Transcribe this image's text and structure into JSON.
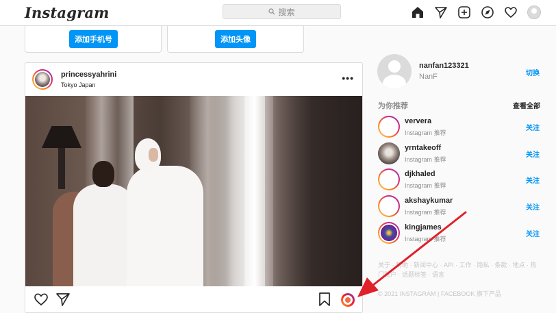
{
  "nav": {
    "logo": "Instagram",
    "search_placeholder": "搜索",
    "icons": [
      "home-icon",
      "direct-icon",
      "new-post-icon",
      "explore-icon",
      "activity-icon",
      "profile-avatar"
    ]
  },
  "cards": [
    {
      "button": "添加手机号"
    },
    {
      "button": "添加头像"
    }
  ],
  "post": {
    "username": "princessyahrini",
    "location": "Tokyo Japan",
    "more": "•••"
  },
  "me": {
    "username": "nanfan123321",
    "fullname": "NanF",
    "switch": "切换"
  },
  "suggestions": {
    "title": "为你推荐",
    "see_all": "查看全部",
    "items": [
      {
        "name": "ververa",
        "sub": "Instagram 推荐",
        "action": "关注"
      },
      {
        "name": "yrntakeoff",
        "sub": "Instagram 推荐",
        "action": "关注"
      },
      {
        "name": "djkhaled",
        "sub": "Instagram 推荐",
        "action": "关注"
      },
      {
        "name": "akshaykumar",
        "sub": "Instagram 推荐",
        "action": "关注"
      },
      {
        "name": "kingjames",
        "sub": "Instagram 推荐",
        "action": "关注"
      }
    ]
  },
  "footer": {
    "links": "关于 · 帮助 · 新闻中心 · API · 工作 · 隐私 · 条款 · 地点 · 热门账户 · 话题标签 · 语言",
    "copyright": "© 2021 INSTAGRAM | FACEBOOK 旗下产品"
  },
  "colors": {
    "accent": "#0095f6",
    "annotation_arrow": "#e0202a"
  }
}
